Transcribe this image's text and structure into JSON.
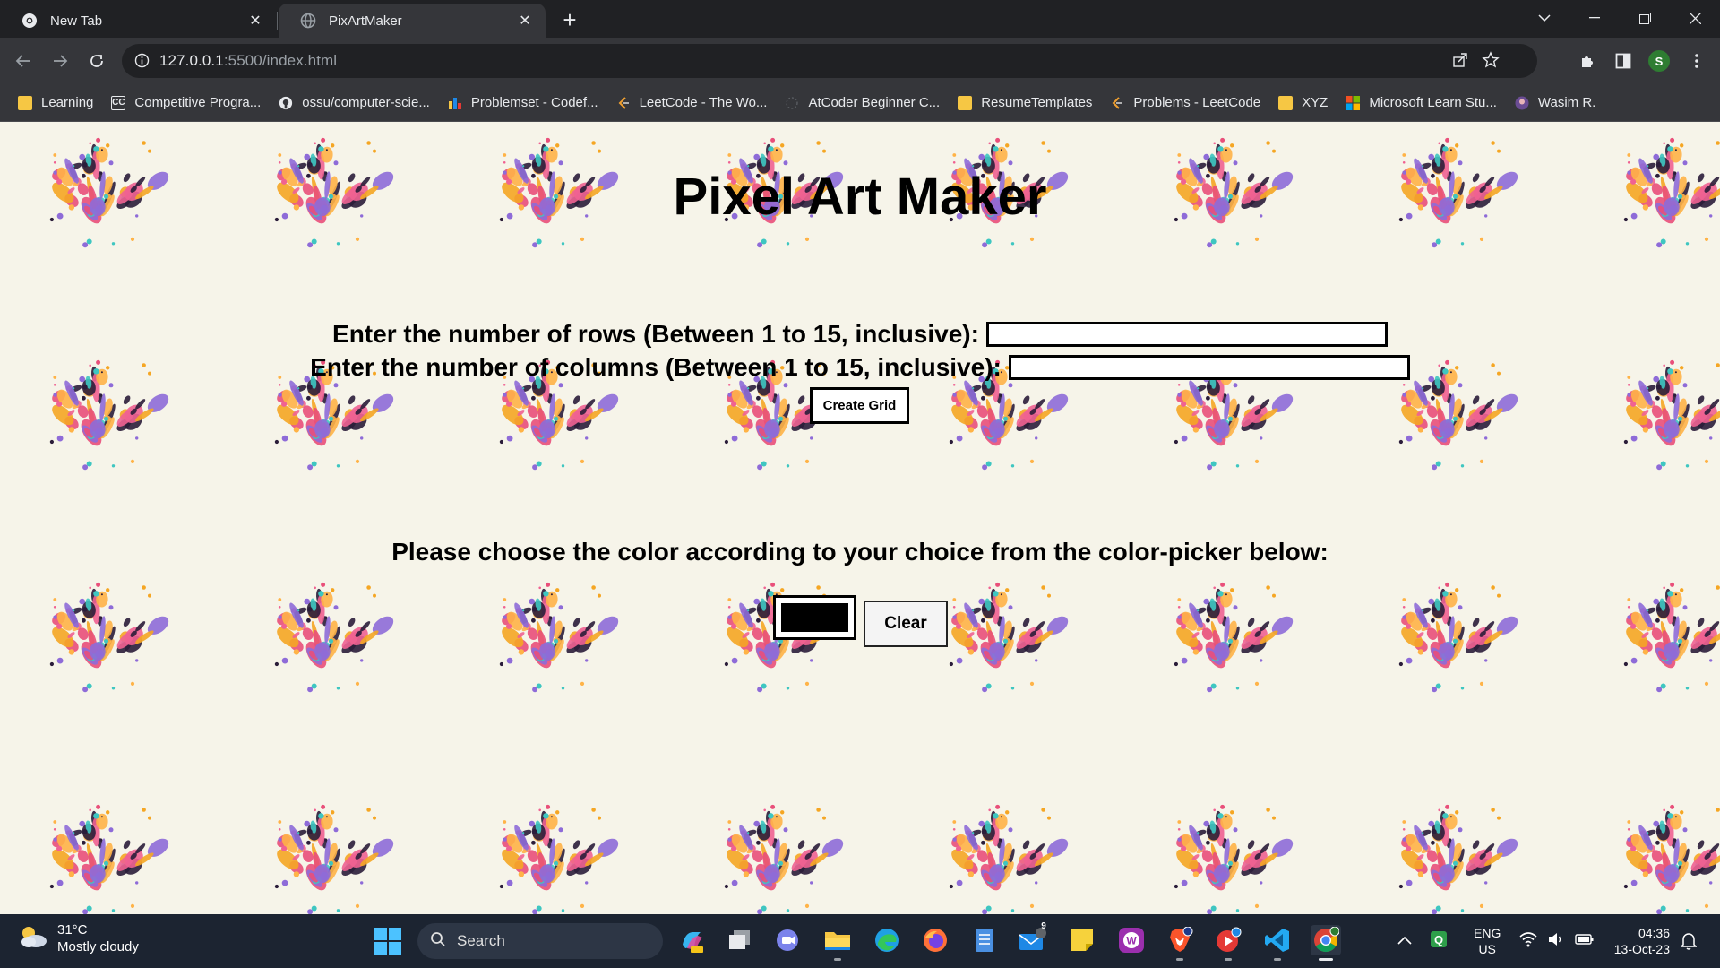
{
  "browser": {
    "tabs": [
      {
        "title": "New Tab",
        "active": false
      },
      {
        "title": "PixArtMaker",
        "active": true
      }
    ],
    "url_host": "127.0.0.1",
    "url_rest": ":5500/index.html",
    "profile_initial": "S",
    "bookmarks": [
      {
        "label": "Learning",
        "icon": "folder-icon"
      },
      {
        "label": "Competitive Progra...",
        "icon": "cc-icon"
      },
      {
        "label": "ossu/computer-scie...",
        "icon": "github-icon"
      },
      {
        "label": "Problemset - Codef...",
        "icon": "codeforces-icon"
      },
      {
        "label": "LeetCode - The Wo...",
        "icon": "leetcode-icon"
      },
      {
        "label": "AtCoder Beginner C...",
        "icon": "atcoder-icon"
      },
      {
        "label": "ResumeTemplates",
        "icon": "folder-icon"
      },
      {
        "label": "Problems - LeetCode",
        "icon": "leetcode-icon"
      },
      {
        "label": "XYZ",
        "icon": "folder-icon"
      },
      {
        "label": "Microsoft Learn Stu...",
        "icon": "microsoft-icon"
      },
      {
        "label": "Wasim R.",
        "icon": "avatar-icon"
      }
    ]
  },
  "page": {
    "title": "Pixel Art Maker",
    "rows_label": "Enter the number of rows (Between 1 to 15, inclusive):",
    "rows_value": "",
    "cols_label": "Enter the number of columns (Between 1 to 15, inclusive):",
    "cols_value": "",
    "create_grid_label": "Create Grid",
    "color_prompt": "Please choose the color according to your choice from the color-picker below:",
    "selected_color": "#000000",
    "clear_label": "Clear",
    "background_color": "#f6f4e9"
  },
  "taskbar": {
    "weather_temp": "31°C",
    "weather_desc": "Mostly cloudy",
    "search_label": "Search",
    "mail_badge": "9",
    "lang_line1": "ENG",
    "lang_line2": "US",
    "time": "04:36",
    "date": "13-Oct-23"
  }
}
